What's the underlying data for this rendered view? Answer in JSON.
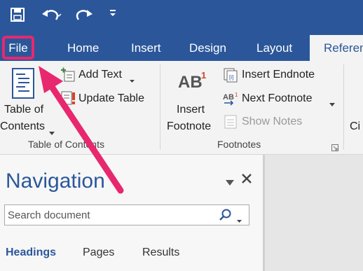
{
  "qat": {
    "save_icon": "save-icon",
    "undo_icon": "undo-icon",
    "redo_icon": "redo-icon",
    "customize_icon": "customize-qat-icon"
  },
  "tabs": [
    {
      "label": "File"
    },
    {
      "label": "Home"
    },
    {
      "label": "Insert"
    },
    {
      "label": "Design"
    },
    {
      "label": "Layout"
    },
    {
      "label": "Referen"
    }
  ],
  "ribbon": {
    "toc": {
      "button_line1": "Table of",
      "button_line2": "Contents",
      "add_text": "Add Text",
      "update_table": "Update Table",
      "group_label": "Table of Contents"
    },
    "footnotes": {
      "insert_footnote_line1": "Insert",
      "insert_footnote_line2": "Footnote",
      "insert_endnote": "Insert Endnote",
      "next_footnote": "Next Footnote",
      "show_notes": "Show Notes",
      "group_label": "Footnotes",
      "ab_glyph": "AB",
      "superscript": "1"
    },
    "partial_next": "Ci"
  },
  "navigation": {
    "title": "Navigation",
    "search_placeholder": "Search document",
    "tabs": [
      "Headings",
      "Pages",
      "Results"
    ]
  },
  "colors": {
    "accent": "#2b579a",
    "annotation": "#e8286e"
  }
}
